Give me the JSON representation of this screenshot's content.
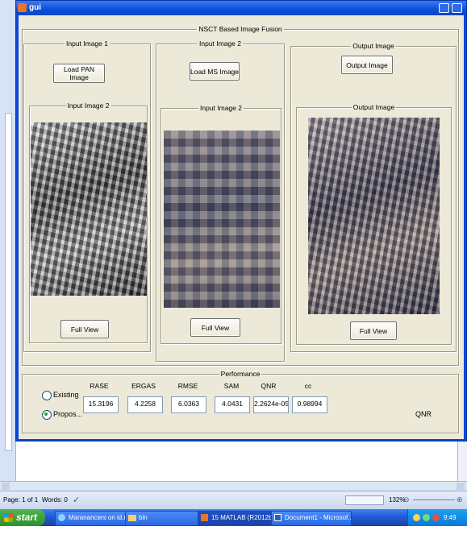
{
  "window": {
    "title": "gui"
  },
  "main_panel": {
    "title": "NSCT Based Image Fusion"
  },
  "input1": {
    "panel_title": "Input Image 1",
    "load_button": "Load PAN Image",
    "sub_panel_title": "Input Image 2",
    "fullview_button": "Full View"
  },
  "input2": {
    "panel_title": "Input Image 2",
    "load_button": "Load MS Image",
    "sub_panel_title": "Input Image 2",
    "fullview_button": "Full View"
  },
  "output": {
    "panel_title": "Output Image",
    "load_button": "Output Image",
    "sub_panel_title": "Output Image",
    "fullview_button": "Full View"
  },
  "performance": {
    "title": "Performance",
    "radios": [
      {
        "label": "Existing",
        "checked": false
      },
      {
        "label": "Propos...",
        "checked": true
      }
    ],
    "metrics": [
      {
        "label": "RASE",
        "value": "15.3196"
      },
      {
        "label": "ERGAS",
        "value": "4.2258"
      },
      {
        "label": "RMSE",
        "value": "6.0363"
      },
      {
        "label": "SAM",
        "value": "4.0431"
      },
      {
        "label": "QNR",
        "value": "2.2624e-05"
      },
      {
        "label": "cc",
        "value": "0.98994"
      }
    ],
    "qnr_label": "QNR"
  },
  "word_status": {
    "page": "Page: 1 of 1",
    "words": "Words: 0",
    "zoom": "132%"
  },
  "taskbar": {
    "start_label": "start",
    "tasks": [
      "Maranancers on id.n...",
      "bin",
      "15 MATLAB (R2012b)",
      "Document1 - Microsof..."
    ],
    "clock": "9:49 AM"
  },
  "colors": {
    "title_bar": "#0a4fd8",
    "client_bg": "#ece9d8",
    "taskbar": "#245edb",
    "start_button": "#3a9a3a"
  }
}
